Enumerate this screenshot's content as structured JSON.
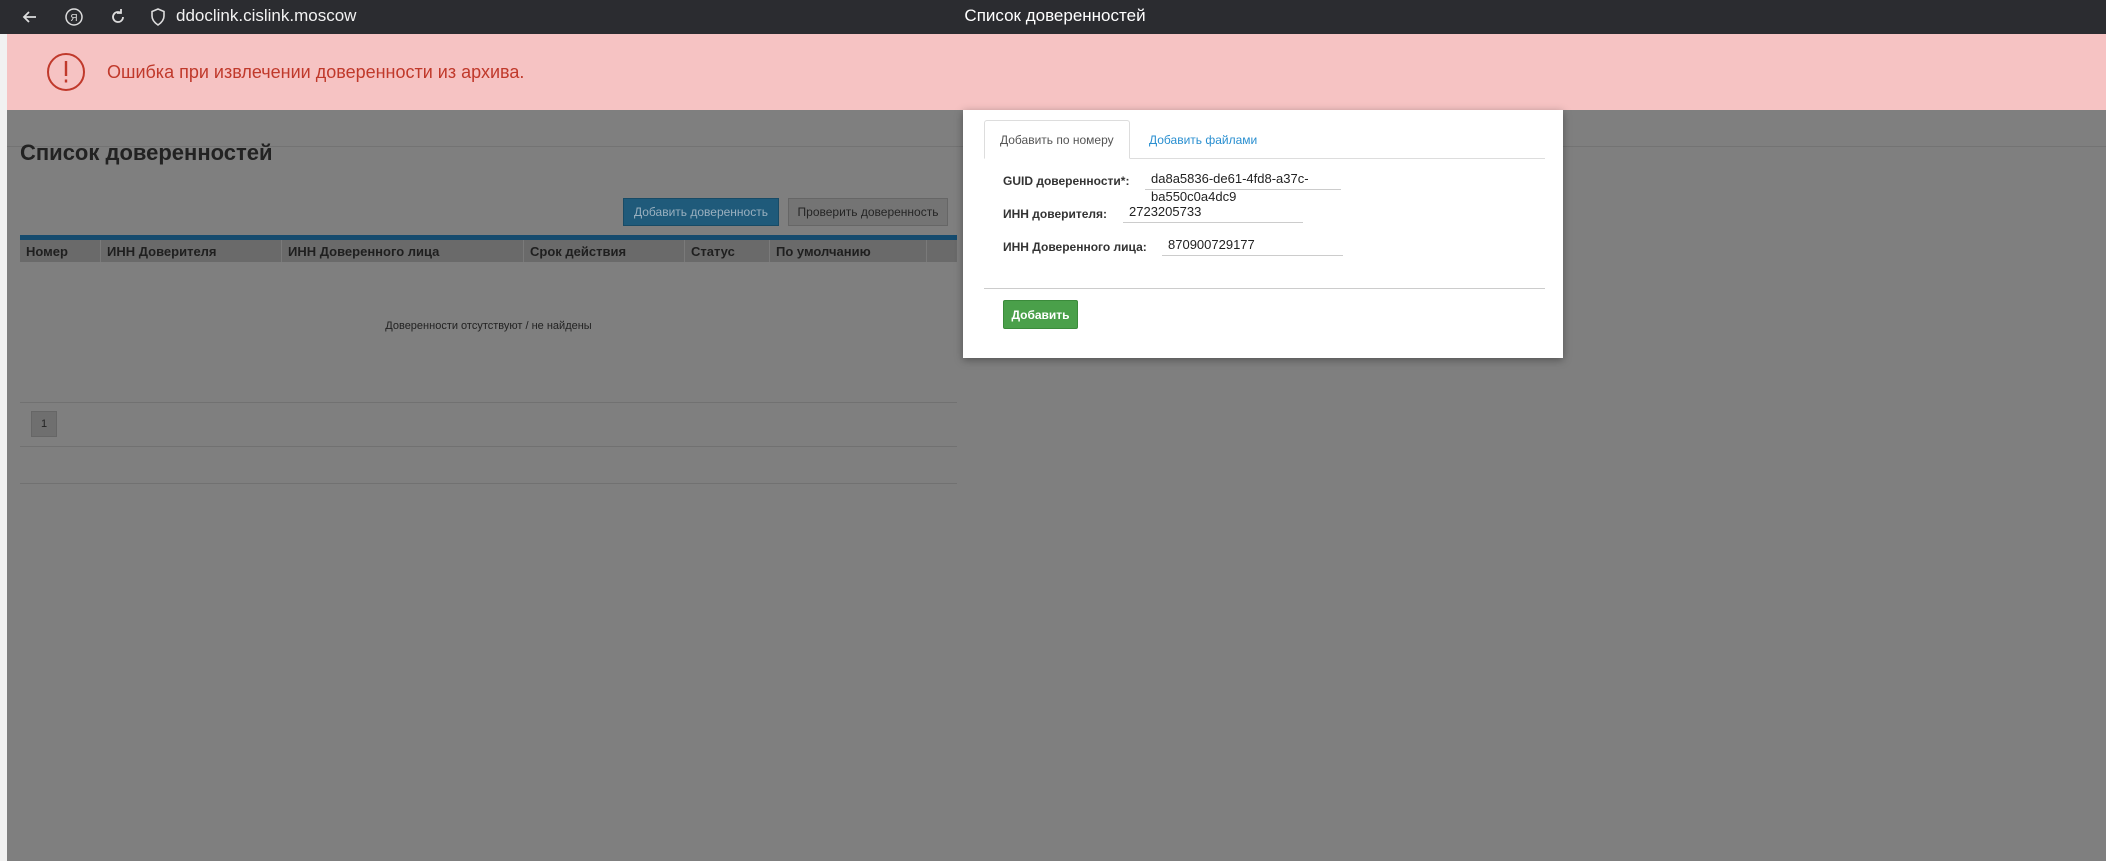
{
  "browser": {
    "url": "ddoclink.cislink.moscow",
    "window_title": "Список доверенностей",
    "yandex_letter": "Я"
  },
  "alert": {
    "text": "Ошибка при извлечении доверенности из архива.",
    "icon": "exclamation-circle-icon",
    "color": "#c0392b"
  },
  "page": {
    "title": "Список доверенностей",
    "buttons": {
      "add_proxy": "Добавить доверенность",
      "check_proxy": "Проверить доверенность"
    },
    "table": {
      "columns": [
        "Номер",
        "ИНН Доверителя",
        "ИНН Доверенного лица",
        "Срок действия",
        "Статус",
        "По умолчанию",
        ""
      ],
      "empty_message": "Доверенности отсутствуют / не найдены"
    },
    "pagination": {
      "current_page": "1"
    }
  },
  "modal": {
    "tabs": {
      "by_number": "Добавить по номеру",
      "by_files": "Добавить файлами"
    },
    "fields": {
      "guid_label": "GUID доверенности*:",
      "guid_value": "da8a5836-de61-4fd8-a37c-ba550c0a4dc9",
      "principal_inn_label": "ИНН доверителя:",
      "principal_inn_value": "2723205733",
      "attorney_inn_label": "ИНН Доверенного лица:",
      "attorney_inn_value": "870900729177"
    },
    "submit_label": "Добавить"
  },
  "colors": {
    "primary": "#1f5a7a",
    "success": "#4aa04a",
    "tab_link": "#2a8fd0",
    "alert_bg": "#f6c3c3"
  }
}
